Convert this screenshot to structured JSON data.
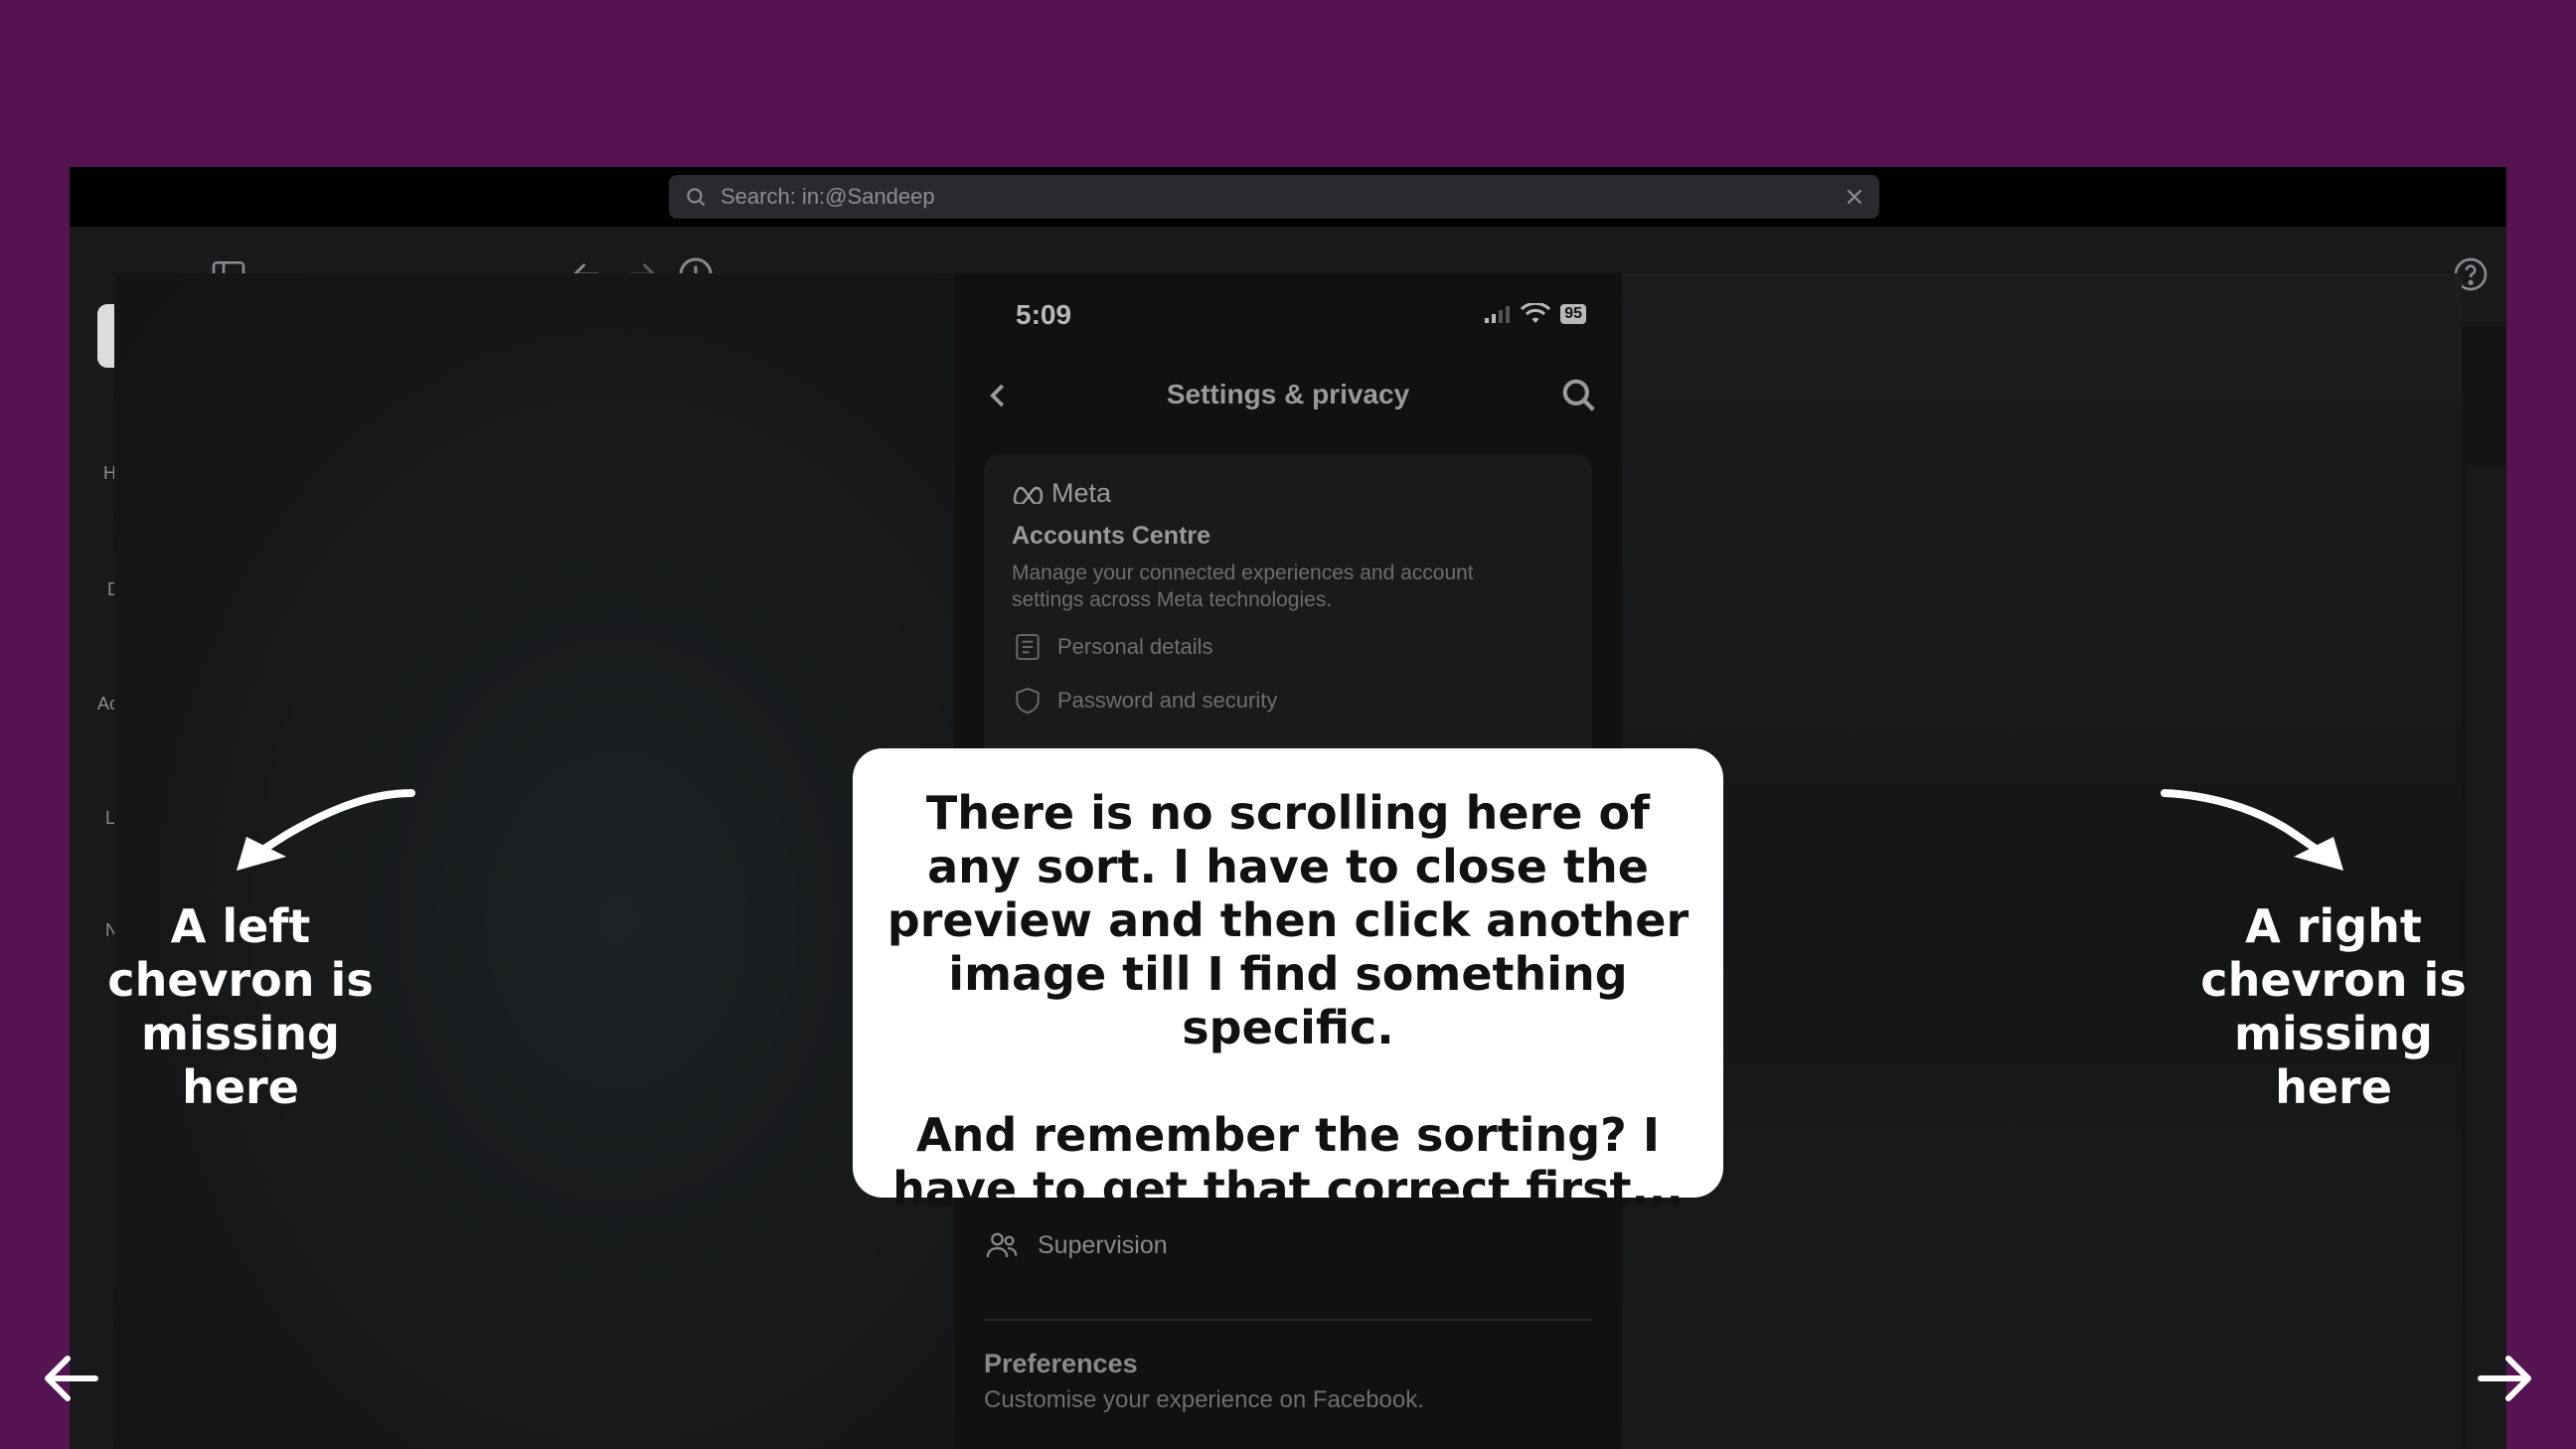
{
  "toolbar": {
    "search_text": "Search: in:@Sandeep"
  },
  "sidebar": {
    "fragments": [
      "H",
      "D",
      "Ac",
      "L",
      "N"
    ]
  },
  "phone": {
    "time": "5:09",
    "battery": "95",
    "title": "Settings & privacy",
    "accounts_centre": {
      "brand": "Meta",
      "title": "Accounts Centre",
      "description": "Manage your connected experiences and account settings across Meta technologies.",
      "items": [
        "Personal details",
        "Password and security"
      ]
    },
    "supervision_label": "Supervision",
    "preferences": {
      "title": "Preferences",
      "description": "Customise your experience on Facebook."
    }
  },
  "callout": {
    "paragraph1": "There is no scrolling here of any sort. I have to close the preview and then click another image till I find something specific.",
    "paragraph2": "And remember the sorting? I have to get that correct first..."
  },
  "annotations": {
    "left": "A left chevron is missing here",
    "right": "A right chevron is missing here"
  },
  "colors": {
    "background": "#551352",
    "callout_bg": "#ffffff"
  }
}
